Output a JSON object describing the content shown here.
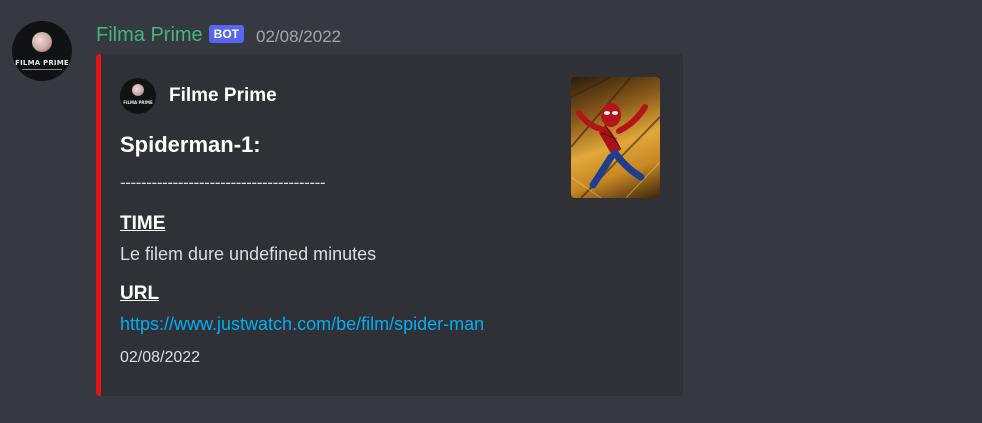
{
  "message": {
    "username": "Filma Prime",
    "bot_tag": "BOT",
    "timestamp": "02/08/2022",
    "avatar_icon": "filma-prime-logo",
    "avatar_text": "FILMA PRIME"
  },
  "embed": {
    "accent_color": "#e31414",
    "author": {
      "name": "Filme Prime",
      "icon": "filma-prime-logo",
      "icon_text": "FILMA PRIME"
    },
    "title": "Spiderman-1:",
    "divider": "---------------------------------------",
    "fields": [
      {
        "name": "TIME",
        "value": "Le filem dure undefined minutes"
      },
      {
        "name": "URL",
        "value": "https://www.justwatch.com/be/film/spider-man"
      }
    ],
    "footer": "02/08/2022",
    "thumbnail": "spider-man-poster"
  },
  "colors": {
    "background": "#36393f",
    "embed_bg": "#2f3136",
    "username": "#43b581",
    "bot_tag": "#5865f2",
    "link": "#00aff4"
  }
}
